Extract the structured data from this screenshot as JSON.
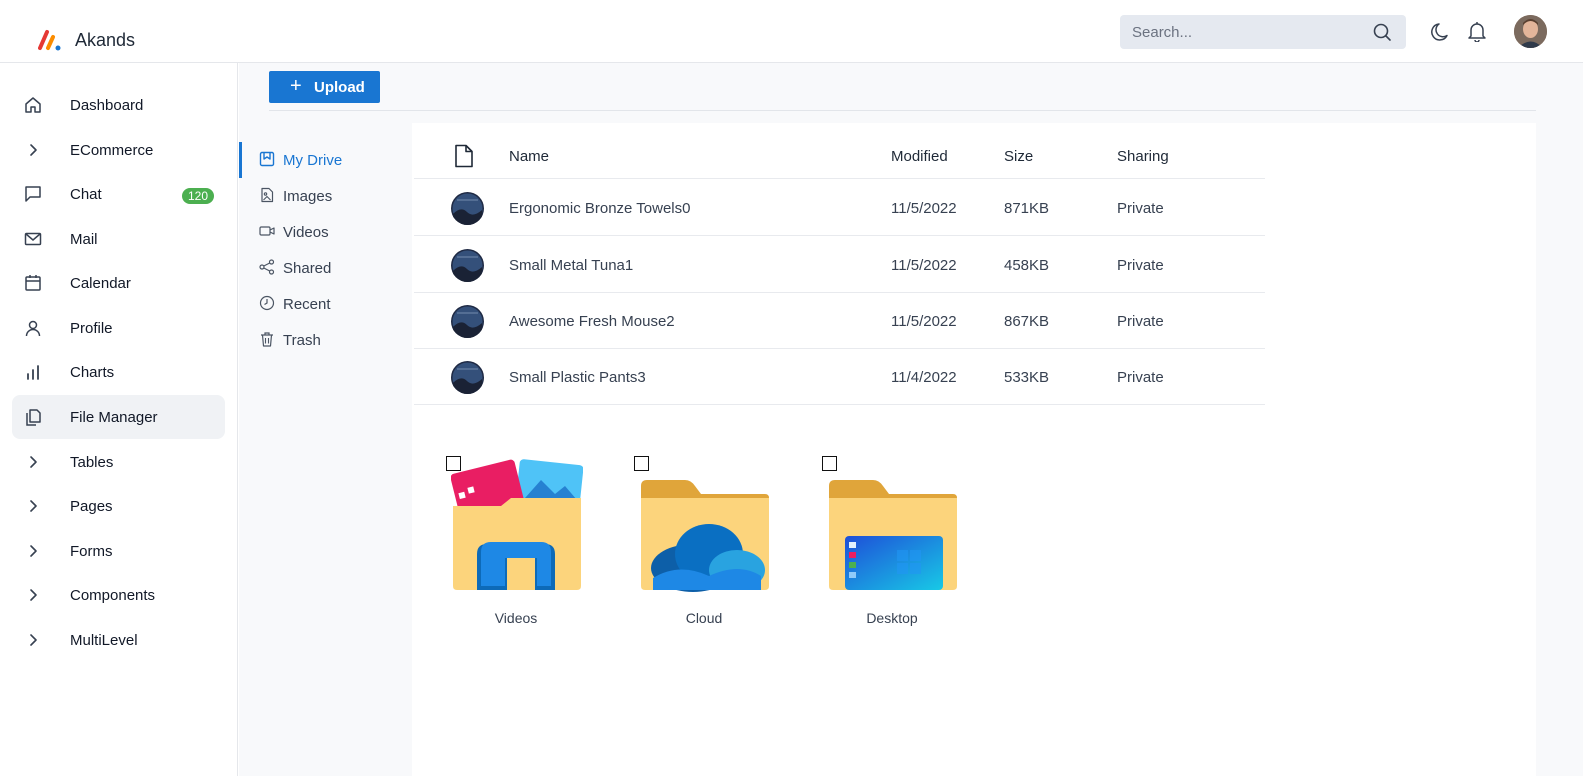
{
  "header": {
    "brand": "Akands",
    "search_placeholder": "Search..."
  },
  "sidebar": {
    "items": [
      {
        "label": "Dashboard",
        "icon": "home-icon"
      },
      {
        "label": "ECommerce",
        "icon": "chevron-right-icon"
      },
      {
        "label": "Chat",
        "icon": "chat-icon",
        "badge": "120"
      },
      {
        "label": "Mail",
        "icon": "mail-icon"
      },
      {
        "label": "Calendar",
        "icon": "calendar-icon"
      },
      {
        "label": "Profile",
        "icon": "user-icon"
      },
      {
        "label": "Charts",
        "icon": "bar-chart-icon"
      },
      {
        "label": "File Manager",
        "icon": "files-icon",
        "active": true
      },
      {
        "label": "Tables",
        "icon": "chevron-right-icon"
      },
      {
        "label": "Pages",
        "icon": "chevron-right-icon"
      },
      {
        "label": "Forms",
        "icon": "chevron-right-icon"
      },
      {
        "label": "Components",
        "icon": "chevron-right-icon"
      },
      {
        "label": "MultiLevel",
        "icon": "chevron-right-icon"
      }
    ]
  },
  "toolbar": {
    "upload_label": "Upload"
  },
  "drive_nav": [
    {
      "label": "My Drive",
      "icon": "bookmark-icon",
      "active": true
    },
    {
      "label": "Images",
      "icon": "image-icon"
    },
    {
      "label": "Videos",
      "icon": "video-icon"
    },
    {
      "label": "Shared",
      "icon": "share-icon"
    },
    {
      "label": "Recent",
      "icon": "clock-icon"
    },
    {
      "label": "Trash",
      "icon": "trash-icon"
    }
  ],
  "files": {
    "columns": [
      "Name",
      "Modified",
      "Size",
      "Sharing"
    ],
    "rows": [
      {
        "name": "Ergonomic Bronze Towels0",
        "modified": "11/5/2022",
        "size": "871KB",
        "sharing": "Private"
      },
      {
        "name": "Small Metal Tuna1",
        "modified": "11/5/2022",
        "size": "458KB",
        "sharing": "Private"
      },
      {
        "name": "Awesome Fresh Mouse2",
        "modified": "11/5/2022",
        "size": "867KB",
        "sharing": "Private"
      },
      {
        "name": "Small Plastic Pants3",
        "modified": "11/4/2022",
        "size": "533KB",
        "sharing": "Private"
      }
    ]
  },
  "folders": [
    {
      "label": "Videos",
      "icon": "videos-folder-icon"
    },
    {
      "label": "Cloud",
      "icon": "cloud-folder-icon"
    },
    {
      "label": "Desktop",
      "icon": "desktop-folder-icon"
    }
  ],
  "colors": {
    "accent": "#1976d2",
    "badge": "#4caf50",
    "folder_front": "#fcd47c",
    "folder_back": "#e0a53a"
  }
}
